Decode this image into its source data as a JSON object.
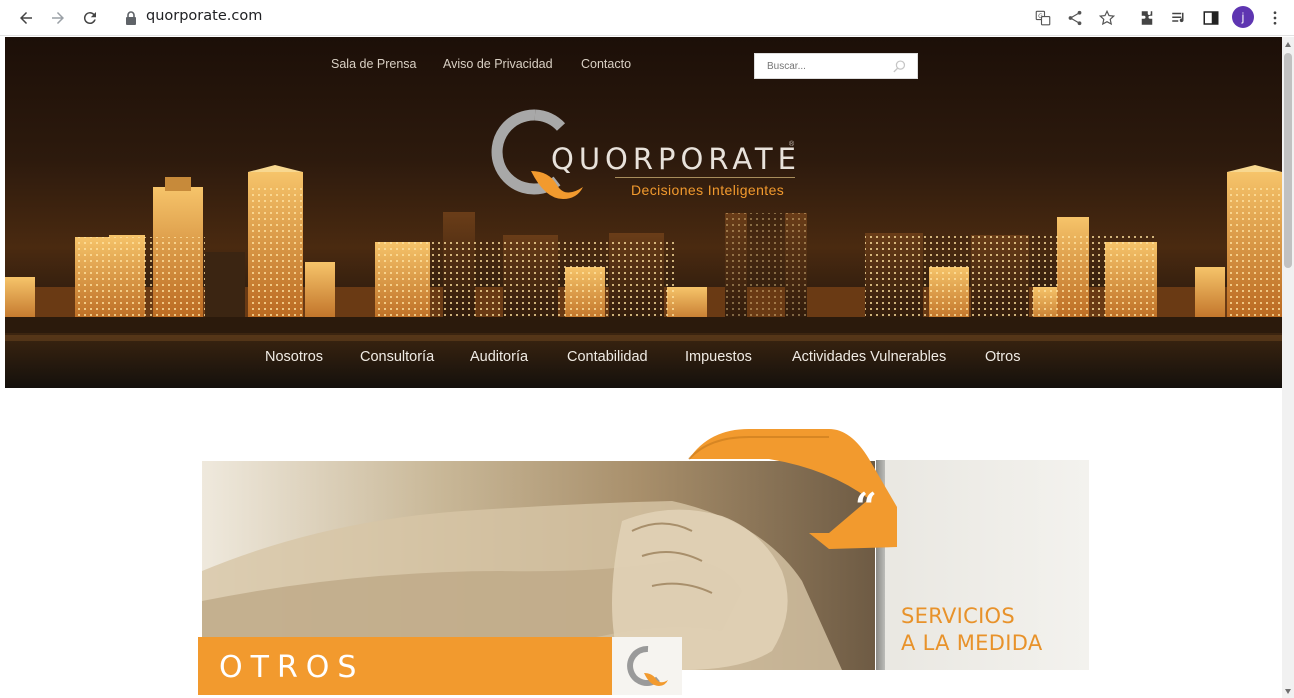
{
  "browser": {
    "url": "quorporate.com",
    "avatar_letter": "j",
    "icons": [
      "back-arrow-icon",
      "forward-arrow-icon",
      "reload-icon",
      "lock-icon",
      "translate-icon",
      "share-icon",
      "star-icon",
      "extensions-icon",
      "media-icon",
      "side-panel-icon",
      "menu-icon"
    ]
  },
  "header": {
    "top_links": [
      "Sala de Prensa",
      "Aviso de Privacidad",
      "Contacto"
    ],
    "search_placeholder": "Buscar...",
    "logo": {
      "name": "QUORPORATE",
      "registered": "®",
      "tagline": "Decisiones Inteligentes"
    },
    "main_nav": [
      "Nosotros",
      "Consultoría",
      "Auditoría",
      "Contabilidad",
      "Impuestos",
      "Actividades Vulnerables",
      "Otros"
    ]
  },
  "banner": {
    "quote_mark": "“",
    "panel_line1": "SERVICIOS",
    "panel_line2": "A LA MEDIDA",
    "section_title": "OTROS"
  },
  "colors": {
    "accent_orange": "#f29a2e",
    "header_dark": "#2d1a0d",
    "avatar": "#5e35b1"
  }
}
